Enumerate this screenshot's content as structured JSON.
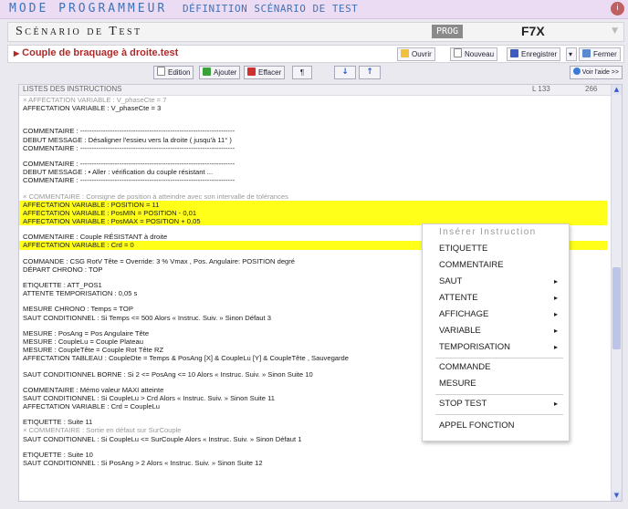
{
  "topbar": {
    "mode_title": "MODE PROGRAMMEUR",
    "definition_title": "DÉFINITION SCÉNARIO DE TEST",
    "info_icon": "info-icon",
    "info_label": "i"
  },
  "scenario": {
    "title": "Scénario de Test",
    "prog_badge": "PROG",
    "code": "F7X"
  },
  "file": {
    "name": "Couple de braquage à droite.test",
    "buttons": {
      "open": "Ouvrir",
      "new": "Nouveau",
      "save": "Enregistrer",
      "close": "Fermer"
    }
  },
  "toolbar": {
    "edit": "Edition",
    "add": "Ajouter",
    "delete": "Effacer",
    "pilcrow": "¶",
    "down": "↓",
    "up": "↑",
    "help": "Voir l'aide >>"
  },
  "list": {
    "header": "LISTES DES INSTRUCTIONS",
    "line_label": "L 133",
    "count": "266",
    "lines": [
      {
        "t": "× AFFECTATION VARIABLE : V_phaseCte = 7",
        "c": "muted"
      },
      {
        "t": "AFFECTATION VARIABLE : V_phaseCte = 3",
        "c": ""
      },
      {
        "t": "",
        "c": "gap"
      },
      {
        "t": "",
        "c": "gap"
      },
      {
        "t": "COMMENTAIRE : -------------------------------------------------------------------",
        "c": ""
      },
      {
        "t": "DEBUT MESSAGE : Désaligner l'essieu vers la droite ( jusqu'à 11° )",
        "c": ""
      },
      {
        "t": "COMMENTAIRE : -------------------------------------------------------------------",
        "c": ""
      },
      {
        "t": "",
        "c": "gap"
      },
      {
        "t": "COMMENTAIRE : -------------------------------------------------------------------",
        "c": ""
      },
      {
        "t": "DEBUT MESSAGE :     • Aller : vérification du couple résistant ...",
        "c": ""
      },
      {
        "t": "COMMENTAIRE : -------------------------------------------------------------------",
        "c": ""
      },
      {
        "t": "",
        "c": "gap"
      },
      {
        "t": "× COMMENTAIRE : Consigne de position à atteindre avec son intervalle de tolérances",
        "c": "muted"
      },
      {
        "t": "AFFECTATION VARIABLE : POSITION = 11",
        "c": "hl"
      },
      {
        "t": "AFFECTATION VARIABLE : PosMIN = POSITION - 0,01",
        "c": "hl"
      },
      {
        "t": "AFFECTATION VARIABLE : PosMAX = POSITION + 0,05",
        "c": "hl"
      },
      {
        "t": "",
        "c": "gap"
      },
      {
        "t": "COMMENTAIRE : Couple RÉSISTANT à droite",
        "c": ""
      },
      {
        "t": "AFFECTATION VARIABLE : Crd = 0",
        "c": "hl"
      },
      {
        "t": "",
        "c": "gap"
      },
      {
        "t": "COMMANDE : CSG RotV Tête = Override: 3 % Vmax ,  Pos. Angulaire: POSITION degré",
        "c": ""
      },
      {
        "t": "DÉPART CHRONO : TOP",
        "c": ""
      },
      {
        "t": "",
        "c": "gap"
      },
      {
        "t": "ETIQUETTE : ATT_POS1",
        "c": ""
      },
      {
        "t": "ATTENTE TEMPORISATION : 0,05 s",
        "c": ""
      },
      {
        "t": "",
        "c": "gap"
      },
      {
        "t": "MESURE CHRONO : Temps = TOP",
        "c": ""
      },
      {
        "t": "SAUT CONDITIONNEL : Si Temps <= 500 Alors « Instruc. Suiv. » Sinon Défaut 3",
        "c": ""
      },
      {
        "t": "",
        "c": "gap"
      },
      {
        "t": "MESURE : PosAng = Pos Angulaire Tête",
        "c": ""
      },
      {
        "t": "MESURE : CoupleLu = Couple Plateau",
        "c": ""
      },
      {
        "t": "MESURE : CoupleTête = Couple Rot Tête RZ",
        "c": ""
      },
      {
        "t": "AFFECTATION TABLEAU : CoupleDte = Temps & PosAng [X] & CoupleLu [Y] & CoupleTête , Sauvegarde",
        "c": ""
      },
      {
        "t": "",
        "c": "gap"
      },
      {
        "t": "SAUT CONDITIONNEL BORNE : Si 2 <= PosAng <= 10 Alors « Instruc. Suiv. » Sinon Suite 10",
        "c": ""
      },
      {
        "t": "",
        "c": "gap"
      },
      {
        "t": "COMMENTAIRE : Mémo valeur MAXI atteinte",
        "c": ""
      },
      {
        "t": "SAUT CONDITIONNEL : Si CoupleLu > Crd Alors « Instruc. Suiv. » Sinon Suite 11",
        "c": ""
      },
      {
        "t": "AFFECTATION VARIABLE : Crd = CoupleLu",
        "c": ""
      },
      {
        "t": "",
        "c": "gap"
      },
      {
        "t": "ETIQUETTE : Suite 11",
        "c": ""
      },
      {
        "t": "× COMMENTAIRE : Sortie en défaut sur SurCouple",
        "c": "muted"
      },
      {
        "t": "SAUT CONDITIONNEL : Si CoupleLu <= SurCouple Alors « Instruc. Suiv. » Sinon Défaut 1",
        "c": ""
      },
      {
        "t": "",
        "c": "gap"
      },
      {
        "t": "ETIQUETTE : Suite 10",
        "c": ""
      },
      {
        "t": "SAUT CONDITIONNEL : Si PosAng > 2 Alors « Instruc. Suiv. » Sinon Suite 12",
        "c": ""
      }
    ]
  },
  "context_menu": {
    "header": "Insérer Instruction",
    "items": [
      {
        "label": "ETIQUETTE",
        "sub": ""
      },
      {
        "label": "COMMENTAIRE",
        "sub": ""
      },
      {
        "label": "SAUT",
        "sub": "▸"
      },
      {
        "label": "ATTENTE",
        "sub": "▸"
      },
      {
        "label": "AFFICHAGE",
        "sub": "▸"
      },
      {
        "label": "VARIABLE",
        "sub": "▸"
      },
      {
        "label": "TEMPORISATION",
        "sub": "▸"
      },
      {
        "label": "COMMANDE",
        "sub": ""
      },
      {
        "label": "MESURE",
        "sub": ""
      },
      {
        "label": "STOP TEST",
        "sub": "▸"
      },
      {
        "label": "APPEL FONCTION",
        "sub": ""
      }
    ]
  },
  "colors": {
    "highlight": "#ffff1a",
    "accent": "#3f73b8",
    "file_name": "#b02a2a"
  }
}
